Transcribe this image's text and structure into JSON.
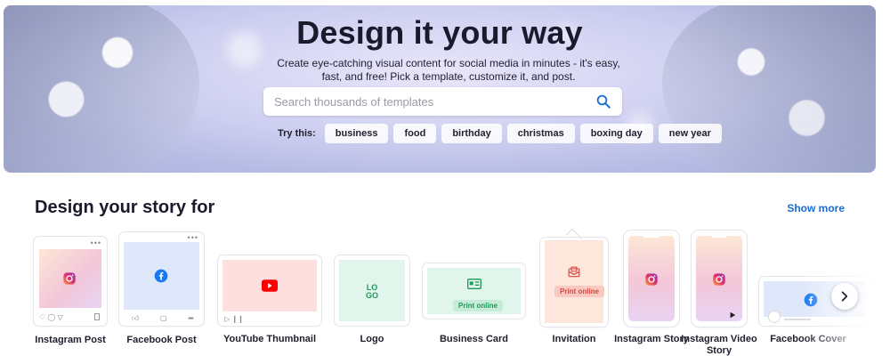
{
  "hero": {
    "title": "Design it your way",
    "subtitle": "Create eye-catching visual content for social media in minutes - it's easy, fast, and free! Pick a template, customize it, and post.",
    "search_placeholder": "Search thousands of templates",
    "try_label": "Try this:",
    "chips": [
      "business",
      "food",
      "birthday",
      "christmas",
      "boxing day",
      "new year"
    ]
  },
  "section": {
    "title": "Design your story for",
    "show_more": "Show more"
  },
  "cards": [
    {
      "label": "Instagram Post"
    },
    {
      "label": "Facebook Post"
    },
    {
      "label": "YouTube Thumbnail"
    },
    {
      "label": "Logo",
      "logo_text_top": "LO",
      "logo_text_bottom": "GO"
    },
    {
      "label": "Business Card",
      "badge": "Print online"
    },
    {
      "label": "Invitation",
      "badge": "Print online"
    },
    {
      "label": "Instagram Story"
    },
    {
      "label": "Instagram Video Story"
    },
    {
      "label": "Facebook Cover"
    }
  ],
  "icons": {
    "search": "search-icon",
    "next": "chevron-right-icon",
    "instagram": "instagram-icon",
    "facebook": "facebook-icon",
    "youtube": "youtube-play-icon"
  },
  "colors": {
    "accent": "#1a6cd6",
    "instagram_grad_a": "#f3c6d8",
    "facebook_blue": "#1877f2",
    "youtube_red": "#ff0000",
    "print_green": "#1f9a5b",
    "print_red": "#d8463f"
  }
}
